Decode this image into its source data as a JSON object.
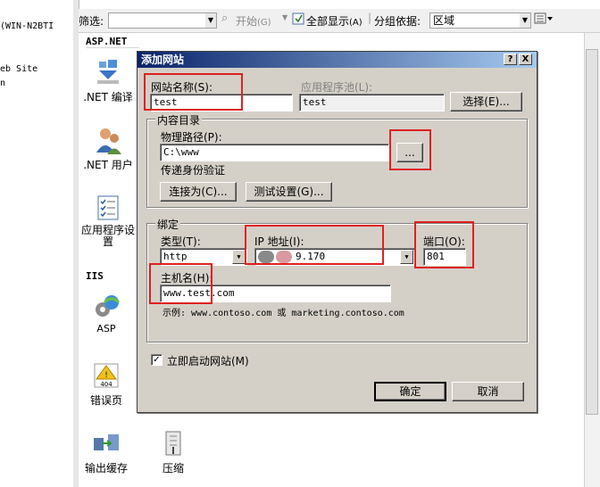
{
  "left_pane": {
    "lines": [
      "(WIN-N2BTI",
      "eb Site",
      "n"
    ]
  },
  "filter_bar": {
    "filter_label": "筛选:",
    "start_label": "开始",
    "start_key": "(G)",
    "show_all_label": "全部显示",
    "show_all_key": "(A)",
    "group_label": "分组依据:",
    "group_value": "区域"
  },
  "features": {
    "aspnet_header": "ASP.NET",
    "iis_header": "IIS",
    "items": {
      "net_compile": ".NET 编译",
      "net_users": ".NET 用户",
      "app_settings": "应用程序设置",
      "asp": "ASP",
      "error_pages": "错误页",
      "output_cache": "输出缓存",
      "compression": "压缩"
    }
  },
  "dialog": {
    "title": "添加网站",
    "help_btn": "?",
    "close_btn": "X",
    "site_name_label": "网站名称(S):",
    "site_name_value": "test",
    "app_pool_label": "应用程序池(L):",
    "app_pool_value": "test",
    "select_button": "选择(E)...",
    "content_group": "内容目录",
    "physical_path_label": "物理路径(P):",
    "physical_path_value": "C:\\www",
    "browse_button": "...",
    "pass_through_label": "传递身份验证",
    "connect_as_button": "连接为(C)...",
    "test_settings_button": "测试设置(G)...",
    "binding_group": "绑定",
    "type_label": "类型(T):",
    "type_value": "http",
    "ip_label": "IP 地址(I):",
    "ip_value": "9.170",
    "port_label": "端口(O):",
    "port_value": "801",
    "host_label": "主机名(H):",
    "host_value": "www.test.com",
    "example_text": "示例: www.contoso.com 或 marketing.contoso.com",
    "start_now_label": "立即启动网站(M)",
    "start_now_checked": true,
    "ok_button": "确定",
    "cancel_button": "取消"
  },
  "colors": {
    "highlight_box": "#e02020",
    "title_gradient_start": "#0a246a",
    "dialog_face": "#d4d0c8"
  }
}
